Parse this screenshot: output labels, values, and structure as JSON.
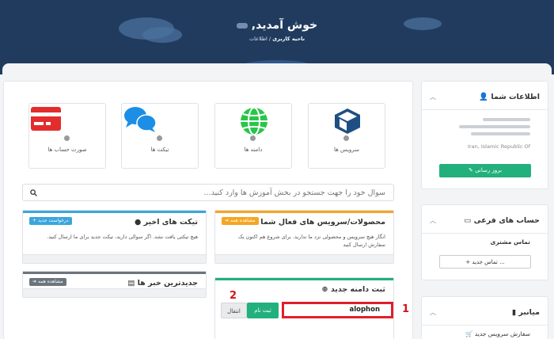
{
  "header": {
    "title": "خوش آمدید,",
    "crumb_current": "ناحیه کاربری",
    "crumb_home": "اطلاعات",
    "crumb_sep": "/"
  },
  "tiles": [
    {
      "label": "سرویس ها",
      "icon": "cube-icon"
    },
    {
      "label": "دامنه ها",
      "icon": "globe-icon"
    },
    {
      "label": "تیکت ها",
      "icon": "chat-bubbles-icon"
    },
    {
      "label": "صورت حساب ها",
      "icon": "credit-card-icon"
    }
  ],
  "search": {
    "placeholder": "سوال خود را جهت جستجو در بخش آموزش ها وارد کنید..."
  },
  "cards": {
    "products": {
      "title": "محصولات/سرویس های فعال شما",
      "badge": "مشاهده همه",
      "body": "انگار هیچ سرویس و محصولی نزد ما ندارید. برای شروع هم اکنون یک سفارش ارسال کنید"
    },
    "tickets": {
      "title": "تیکت های اخیر",
      "badge": "درخواست جدید",
      "body": "هیچ تیکتی یافت نشد. اگر سوالی دارید، تیکت جدید برای ما ارسال کنید."
    },
    "news": {
      "title": "جدیدترین خبر ها",
      "badge": "مشاهده همه"
    },
    "domain": {
      "title": "ثبت دامنه جدید",
      "input_value": "alophon",
      "register": "ثبت نام",
      "transfer": "انتقال"
    }
  },
  "markers": {
    "one": "1",
    "two": "2"
  },
  "sidebar": {
    "info": {
      "title": "اطلاعات شما",
      "country": "Iran, Islamic Republic Of",
      "update": "بروز رسانی"
    },
    "subaccounts": {
      "title": "حساب های فرعی",
      "contact": "تماس مشتری",
      "new_contact": "تماس جدید ..."
    },
    "shortcuts": {
      "title": "میانبر",
      "order": "سفارش سرویس جدید"
    }
  },
  "colors": {
    "accent_green": "#22b07d",
    "accent_orange": "#f5a623",
    "accent_blue": "#3aa6dc",
    "accent_grey": "#6c757d",
    "marker_red": "#e01f2a",
    "header_bg": "#213b5e"
  }
}
